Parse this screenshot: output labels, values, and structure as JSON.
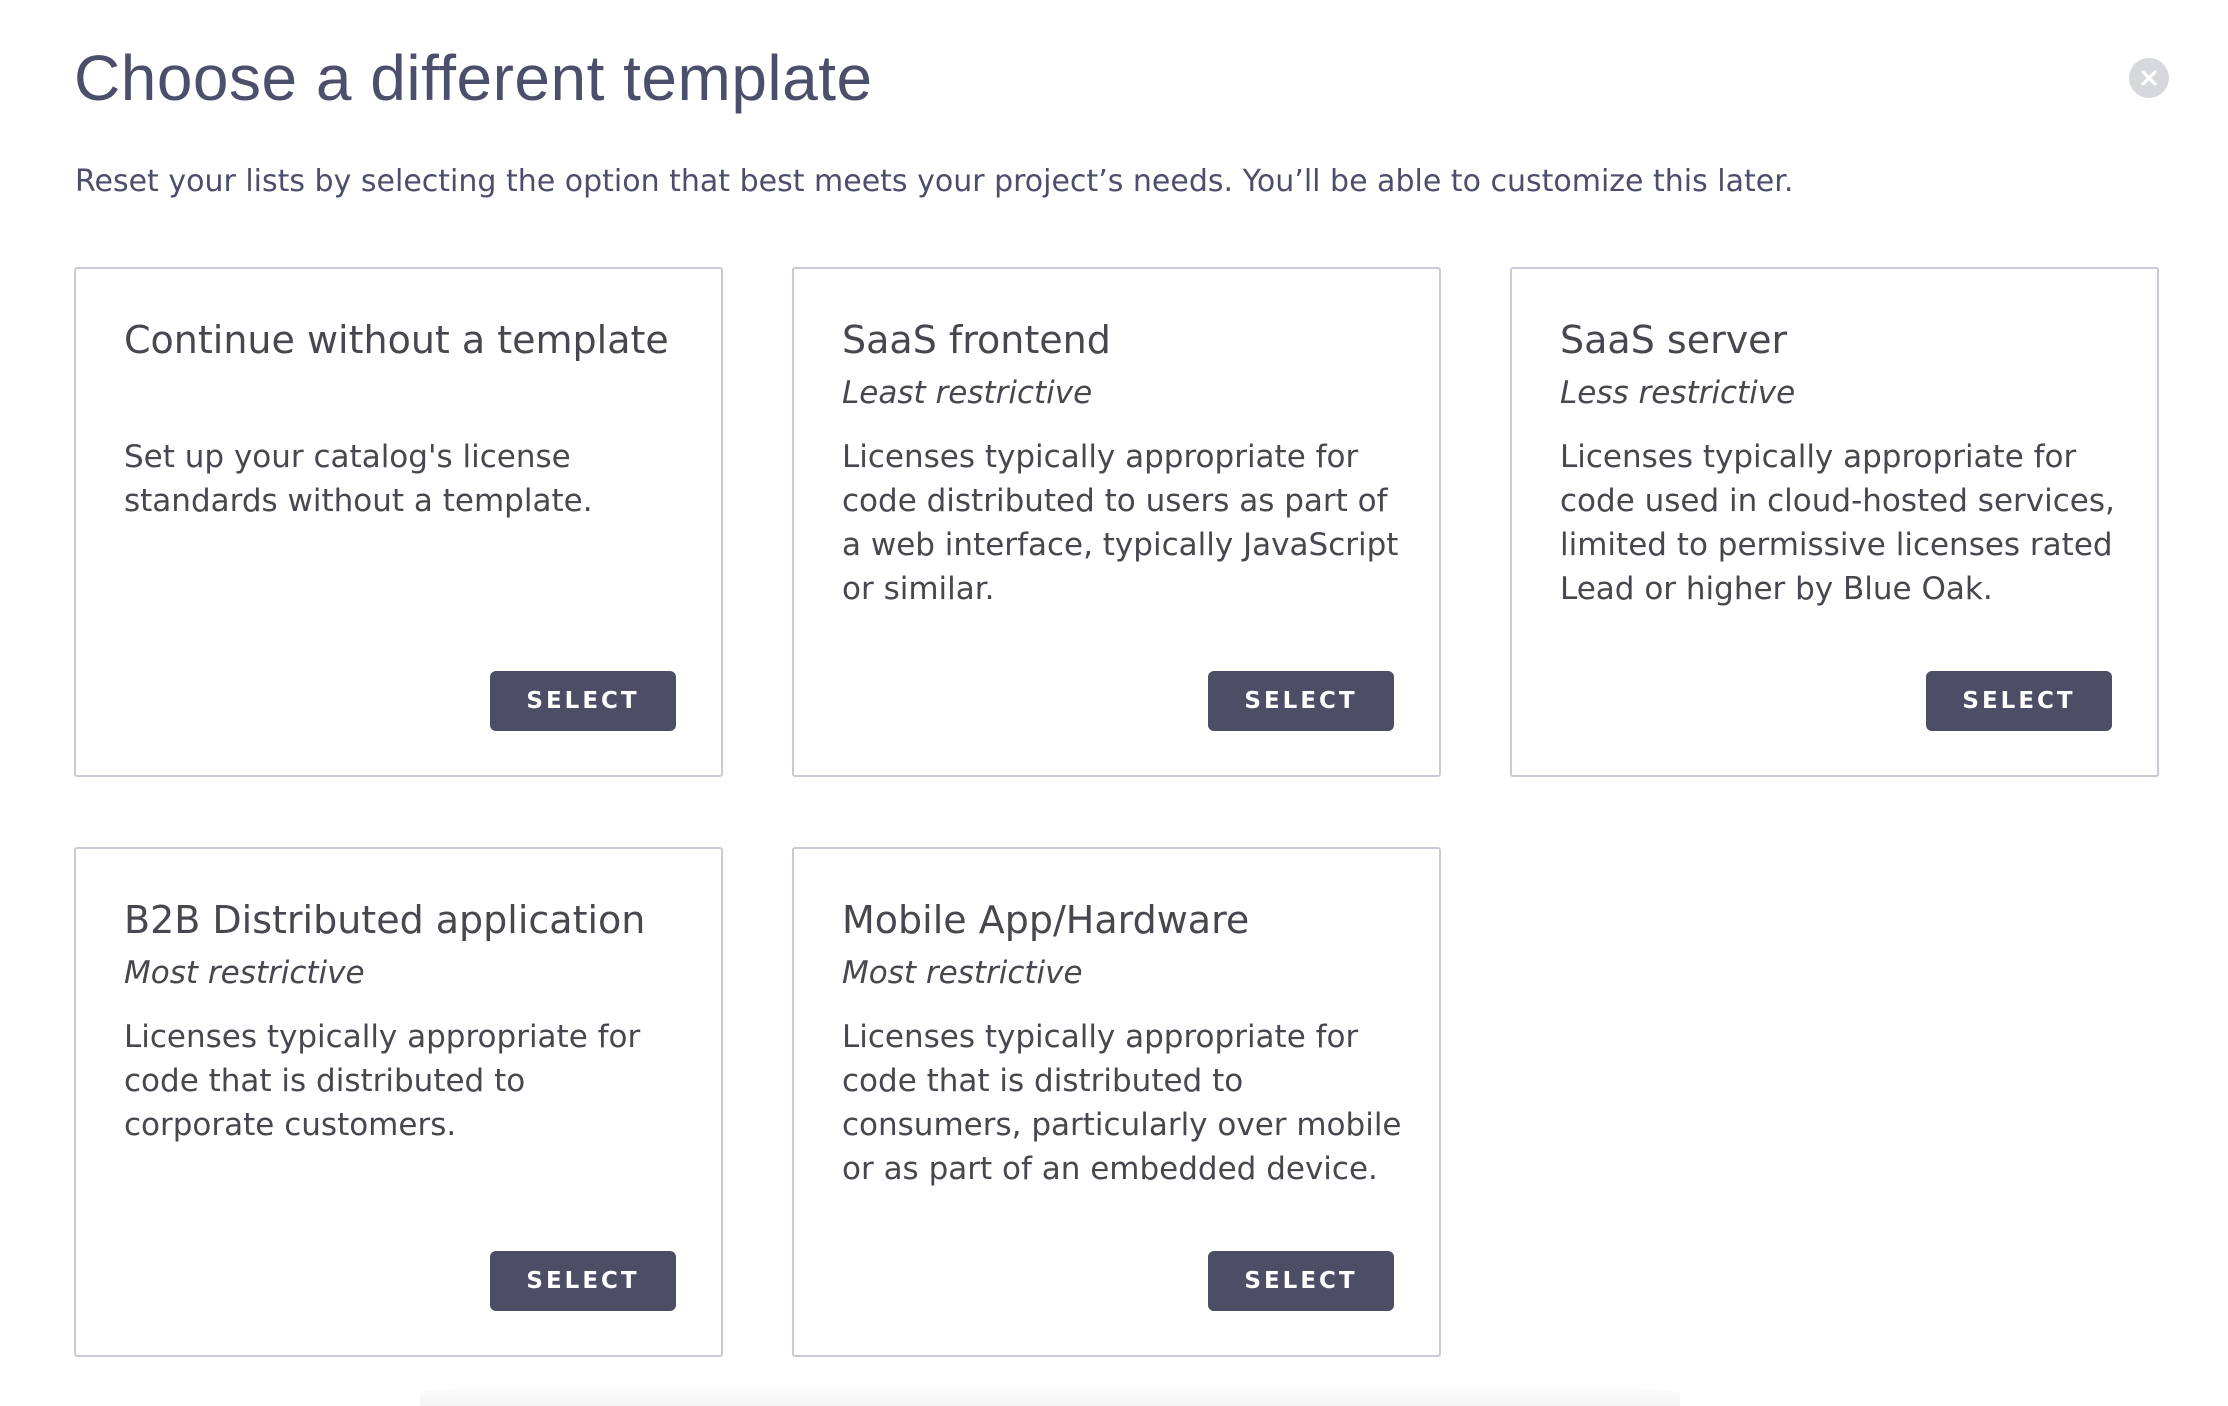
{
  "header": {
    "title": "Choose a different template",
    "subtitle": "Reset your lists by selecting the option that best meets your project’s needs. You’ll be able to customize this later.",
    "close_icon": "close-icon"
  },
  "colors": {
    "title_text": "#4c4f6b",
    "body_text": "#47474f",
    "card_border": "#c9cad6",
    "button_bg": "#4b4e65",
    "button_text": "#ffffff",
    "close_bg": "#d7d8dc"
  },
  "templates": [
    {
      "title": "Continue without a template",
      "subtitle": "",
      "description": "Set up your catalog's license standards without a template.",
      "button_label": "SELECT"
    },
    {
      "title": "SaaS frontend",
      "subtitle": "Least restrictive",
      "description": "Licenses typically appropriate for code distributed to users as part of a web interface, typically JavaScript or similar.",
      "button_label": "SELECT"
    },
    {
      "title": "SaaS server",
      "subtitle": "Less restrictive",
      "description": "Licenses typically appropriate for code used in cloud-hosted services, limited to permissive licenses rated Lead or higher by Blue Oak.",
      "button_label": "SELECT"
    },
    {
      "title": "B2B Distributed application",
      "subtitle": "Most restrictive",
      "description": "Licenses typically appropriate for code that is distributed to corporate customers.",
      "button_label": "SELECT"
    },
    {
      "title": "Mobile App/Hardware",
      "subtitle": "Most restrictive",
      "description": "Licenses typically appropriate for code that is distributed to consumers, particularly over mobile or as part of an embedded device.",
      "button_label": "SELECT"
    }
  ]
}
